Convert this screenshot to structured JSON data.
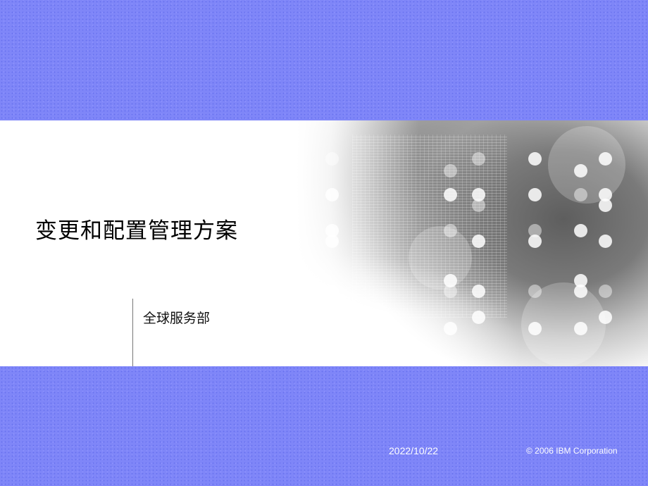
{
  "slide": {
    "title": "变更和配置管理方案",
    "subtitle": "全球服务部",
    "date": "2022/10/22",
    "copyright": "© 2006 IBM Corporation"
  },
  "colors": {
    "band": "#7f86f8",
    "background": "#ffffff",
    "text": "#000000",
    "footer_text": "#ffffff"
  }
}
